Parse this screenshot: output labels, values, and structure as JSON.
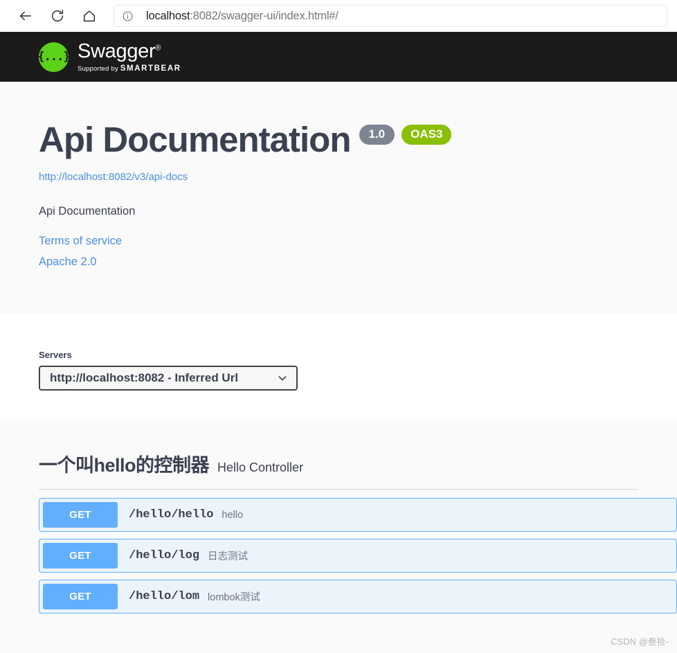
{
  "browser": {
    "back_label": "Back",
    "reload_label": "Reload",
    "home_label": "Home",
    "url_host": "localhost",
    "url_rest": ":8082/swagger-ui/index.html#/",
    "url_full": "localhost:8082/swagger-ui/index.html#/"
  },
  "topbar": {
    "logo_glyph": "{...}",
    "logo_title": "Swagger",
    "trademark": "®",
    "supported_by": "Supported by ",
    "brand": "SMARTBEAR"
  },
  "info": {
    "title": "Api Documentation",
    "version": "1.0",
    "oas_badge": "OAS3",
    "spec_url": "http://localhost:8082/v3/api-docs",
    "description": "Api Documentation",
    "terms_link": "Terms of service",
    "license_link": "Apache 2.0"
  },
  "servers": {
    "label": "Servers",
    "selected": "http://localhost:8082 - Inferred Url",
    "options": [
      "http://localhost:8082 - Inferred Url"
    ]
  },
  "tag": {
    "name": "一个叫hello的控制器",
    "description": "Hello Controller"
  },
  "operations": [
    {
      "method": "GET",
      "path": "/hello/hello",
      "summary": "hello"
    },
    {
      "method": "GET",
      "path": "/hello/log",
      "summary": "日志测试"
    },
    {
      "method": "GET",
      "path": "/hello/lom",
      "summary": "lombok测试"
    }
  ],
  "watermark": "CSDN @叁拾-",
  "colors": {
    "get_blue": "#61affe",
    "get_row_bg": "#ebf3fb",
    "oas_green": "#89bf04",
    "version_gray": "#7d8492",
    "link_blue": "#4990e2",
    "text_dark": "#3b4151",
    "logo_green": "#5bd119"
  }
}
